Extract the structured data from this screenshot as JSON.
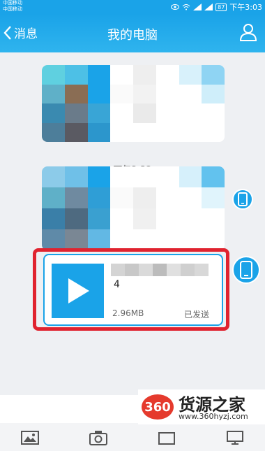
{
  "status_bar": {
    "carrier1": "中国移动",
    "carrier2": "中国移动",
    "battery": "87",
    "time": "下午3:03"
  },
  "nav": {
    "back_label": "消息",
    "title": "我的电脑"
  },
  "chat": {
    "timestamps": [
      "下午2:32",
      "下午3:03"
    ],
    "file": {
      "name": "4",
      "size": "2.96MB",
      "status": "已发送"
    }
  },
  "watermark": {
    "badge": "360",
    "name": "货源之家",
    "url": "www.360hyzj.com"
  },
  "colors": {
    "accent": "#1aa3e8",
    "highlight": "#e0232f"
  }
}
